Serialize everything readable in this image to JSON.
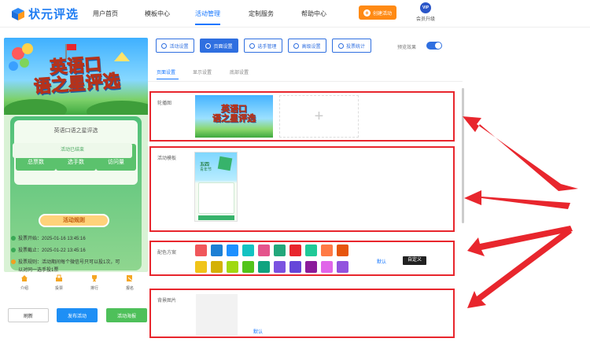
{
  "brand": {
    "name": "状元评选",
    "accent": "#1677ff"
  },
  "nav": {
    "items": [
      {
        "label": "用户首页"
      },
      {
        "label": "模板中心"
      },
      {
        "label": "活动管理",
        "active": true
      },
      {
        "label": "定制服务"
      },
      {
        "label": "帮助中心"
      }
    ],
    "create_label": "创建活动",
    "vip_badge": "VIP",
    "vip_label": "会员升级"
  },
  "preview": {
    "hero_title_line1": "英语口",
    "hero_title_line2": "语之星评选",
    "card_title": "英语口语之星评选",
    "stats": [
      {
        "value": "0",
        "label": "总票数"
      },
      {
        "value": "6",
        "label": "选手数"
      },
      {
        "value": "0",
        "label": "访问量"
      }
    ],
    "ended_label": "活动已结束",
    "rules_title": "活动规则",
    "rules": [
      "投票开始：2025-01-16 13:45:16",
      "投票截止：2025-01-22 13:45:16",
      "投票规则：活动期间每个微信号只可以投1次，可",
      "以对同一选手投1票"
    ],
    "bottom_nav": [
      "介绍",
      "投票",
      "排行",
      "报名"
    ]
  },
  "actions": {
    "refresh": "刷新",
    "publish": "发布活动",
    "poster": "活动海报"
  },
  "settings_tabs": [
    {
      "label": "活动设置",
      "icon": "settings-icon"
    },
    {
      "label": "页面设置",
      "icon": "gear-icon",
      "active": true
    },
    {
      "label": "选手管理",
      "icon": "users-icon"
    },
    {
      "label": "高级设置",
      "icon": "sliders-icon"
    },
    {
      "label": "投票统计",
      "icon": "bar-chart-icon"
    }
  ],
  "preview_toggle": {
    "label": "预览效果",
    "on": true
  },
  "sub_tabs": [
    {
      "label": "页面设置",
      "active": true
    },
    {
      "label": "显示设置"
    },
    {
      "label": "底部设置"
    }
  ],
  "sections": {
    "carousel": {
      "label": "轮播图",
      "thumb_line1": "英语口",
      "thumb_line2": "语之星评选",
      "upload_symbol": "+"
    },
    "template": {
      "label": "活动模板",
      "thumb_text_1": "五四",
      "thumb_text_2": "青年节"
    },
    "colors": {
      "label": "配色方案",
      "swatches": [
        "#f0575b",
        "#1d7fd4",
        "#1e90ff",
        "#13c2c2",
        "#e4548c",
        "#23a77b",
        "#e8262d",
        "#20c997",
        "#ff7a45",
        "#e6550d",
        "#f0c419",
        "#d4b106",
        "#a0d911",
        "#52c41a",
        "#10a37f",
        "#7a52e0",
        "#6546d9",
        "#8b1c9a",
        "#e065e9",
        "#9254de"
      ],
      "default_label": "默认",
      "custom_label": "自定义"
    },
    "background": {
      "label": "背景图片",
      "default_label": "默认"
    }
  }
}
